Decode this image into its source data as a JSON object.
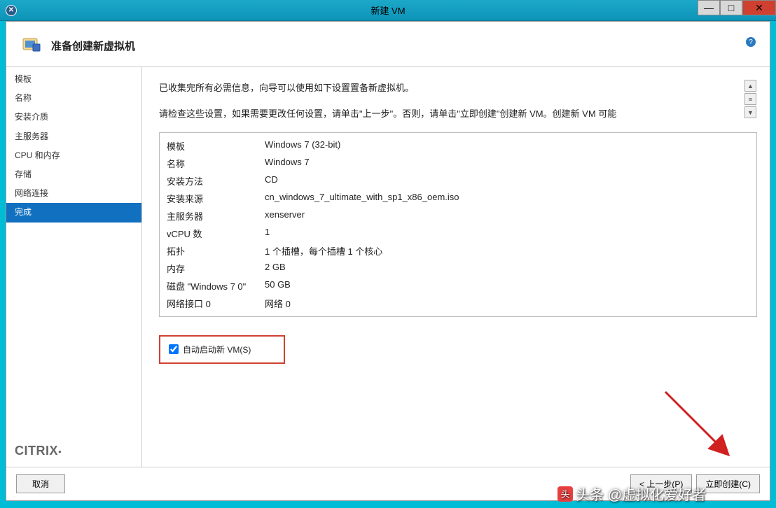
{
  "titlebar": {
    "title": "新建 VM"
  },
  "header": {
    "title": "准备创建新虚拟机"
  },
  "sidebar": {
    "items": [
      {
        "label": "模板"
      },
      {
        "label": "名称"
      },
      {
        "label": "安装介质"
      },
      {
        "label": "主服务器"
      },
      {
        "label": "CPU 和内存"
      },
      {
        "label": "存储"
      },
      {
        "label": "网络连接"
      },
      {
        "label": "完成"
      }
    ],
    "logo": "CITRIX"
  },
  "content": {
    "intro1": "已收集完所有必需信息，向导可以使用如下设置置备新虚拟机。",
    "intro2": "请检查这些设置，如果需要更改任何设置，请单击\"上一步\"。否则，请单击\"立即创建\"创建新 VM。创建新 VM 可能",
    "summary": [
      {
        "label": "模板",
        "value": "Windows 7 (32-bit)"
      },
      {
        "label": "名称",
        "value": "Windows 7"
      },
      {
        "label": "安装方法",
        "value": "CD"
      },
      {
        "label": "安装来源",
        "value": "cn_windows_7_ultimate_with_sp1_x86_oem.iso"
      },
      {
        "label": "主服务器",
        "value": "xenserver"
      },
      {
        "label": "vCPU 数",
        "value": "1"
      },
      {
        "label": "拓扑",
        "value": "1 个插槽，每个插槽 1 个核心"
      },
      {
        "label": "内存",
        "value": "2 GB"
      },
      {
        "label": "磁盘 \"Windows 7 0\"",
        "value": "50 GB"
      },
      {
        "label": "网络接口 0",
        "value": "网络 0"
      }
    ],
    "checkbox_label": "自动启动新 VM(S)"
  },
  "footer": {
    "cancel": "取消",
    "back": "< 上一步(P)",
    "create": "立即创建(C)"
  },
  "watermark": "头条 @虚拟化爱好者"
}
